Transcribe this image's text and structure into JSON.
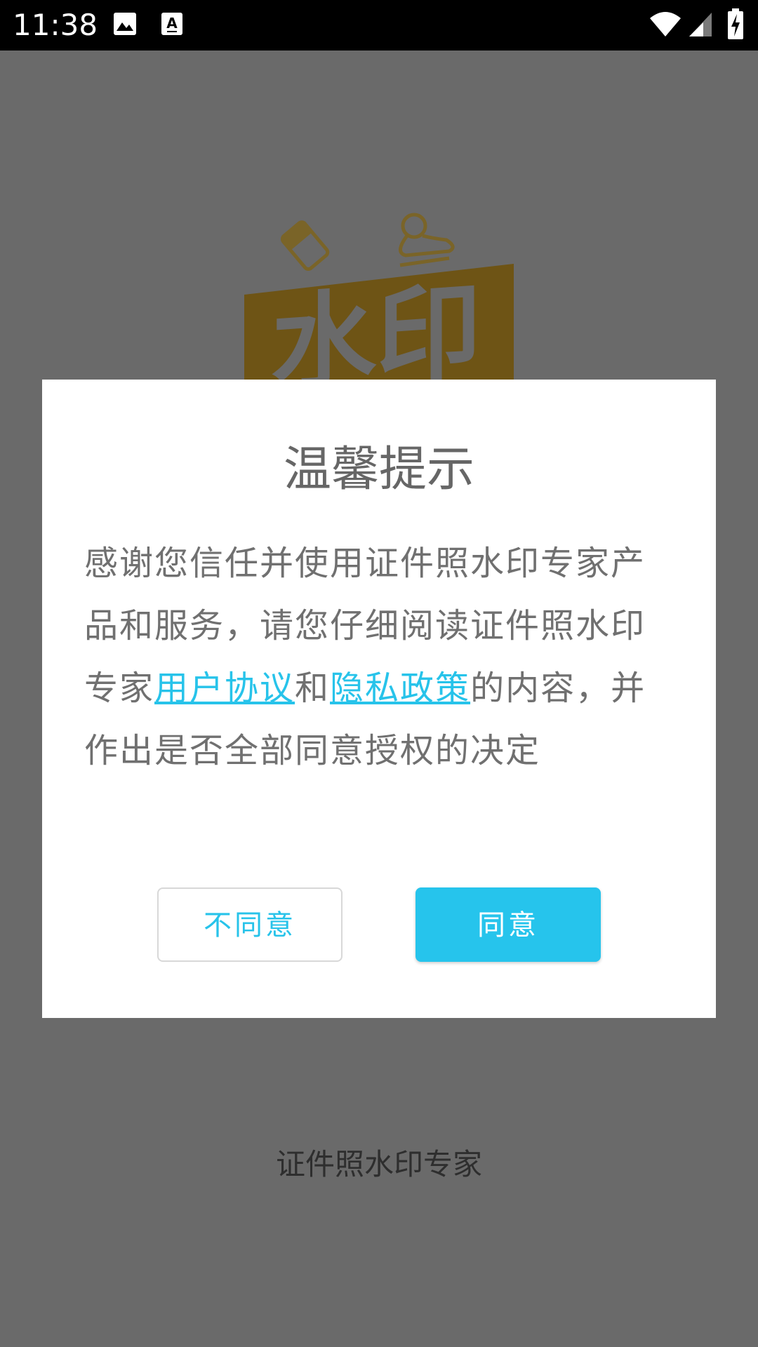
{
  "status_bar": {
    "time": "11:38",
    "icons": [
      "image-icon",
      "text-a-icon",
      "wifi-icon",
      "cell-signal-icon",
      "battery-charging-icon"
    ]
  },
  "splash": {
    "logo_text": "水印",
    "app_name": "证件照水印专家"
  },
  "dialog": {
    "title": "温馨提示",
    "body_prefix": "感谢您信任并使用证件照水印专家产品和服务，请您仔细阅读证件照水印专家",
    "link_user_agreement": "用户协议",
    "body_and": "和",
    "link_privacy_policy": "隐私政策",
    "body_suffix": "的内容，并作出是否全部同意授权的决定",
    "disagree_label": "不同意",
    "agree_label": "同意"
  },
  "colors": {
    "accent": "#26c4ec",
    "overlay": "#6a6a6a",
    "logo_dimmed": "#6e5415"
  }
}
